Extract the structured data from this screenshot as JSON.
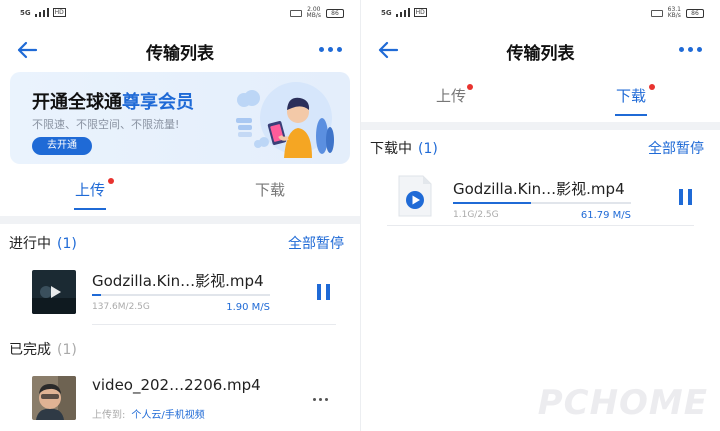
{
  "colors": {
    "accent": "#1f6ad6",
    "badge": "#e8332f",
    "muted": "#aaaaaa"
  },
  "left": {
    "status": {
      "network": "5G",
      "hd": "HD",
      "speed_value": "2.00",
      "speed_unit": "MB/s",
      "battery": "86"
    },
    "title": "传输列表",
    "promo": {
      "title_plain": "开通全球通",
      "title_highlight": "尊享会员",
      "subtitle": "不限速、不限空间、不限流量!",
      "button_label": "去开通"
    },
    "tabs": [
      {
        "label": "上传",
        "active": true,
        "badge": true
      },
      {
        "label": "下载",
        "active": false,
        "badge": false
      }
    ],
    "in_progress": {
      "label": "进行中",
      "count": "(1)",
      "action": "全部暂停",
      "item": {
        "name": "Godzilla.Kin…影视.mp4",
        "size": "137.6M/2.5G",
        "speed": "1.90 M/S",
        "progress": 0.05,
        "icon": "pause-icon"
      }
    },
    "completed": {
      "label": "已完成",
      "count": "(1)",
      "item": {
        "name": "video_202…2206.mp4",
        "uploaded_label": "上传到:",
        "uploaded_path": "个人云/手机视频",
        "icon": "more-icon"
      }
    }
  },
  "right": {
    "status": {
      "network": "5G",
      "hd": "HD",
      "speed_value": "63.1",
      "speed_unit": "KB/s",
      "battery": "86"
    },
    "title": "传输列表",
    "tabs": [
      {
        "label": "上传",
        "active": false,
        "badge": true
      },
      {
        "label": "下载",
        "active": true,
        "badge": true
      }
    ],
    "downloading": {
      "label": "下载中",
      "count": "(1)",
      "action": "全部暂停",
      "item": {
        "name": "Godzilla.Kin…影视.mp4",
        "size": "1.1G/2.5G",
        "speed": "61.79 M/S",
        "progress": 0.44,
        "icon": "pause-icon"
      }
    }
  }
}
